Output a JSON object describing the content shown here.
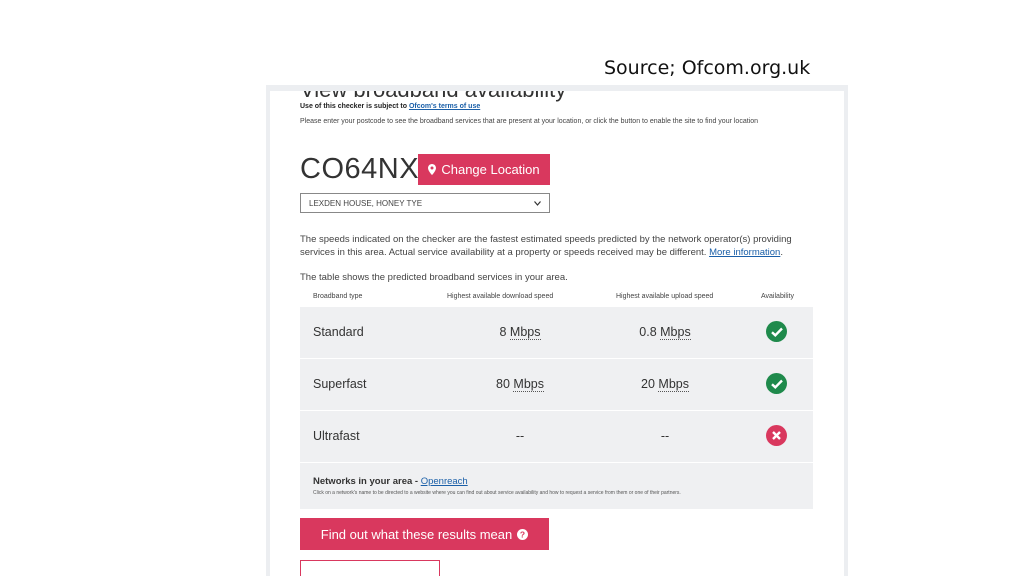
{
  "caption": "Source; Ofcom.org.uk",
  "page": {
    "heading": "View broadband availability",
    "terms_prefix": "Use of this checker is subject to ",
    "terms_link": "Ofcom's terms of use",
    "instructions": "Please enter your postcode to see the broadband services that are present at your location, or click the button to enable the site to find your location",
    "postcode": "CO64NX",
    "change_location_label": "Change Location",
    "address_selected": "LEXDEN HOUSE, HONEY TYE",
    "info_text": "The speeds indicated on the checker are the fastest estimated speeds predicted by the network operator(s) providing services in this area. Actual service availability at a property or speeds received may be different.",
    "more_info_link": "More information",
    "table_intro": "The table shows the predicted broadband services in your area.",
    "find_out_label": "Find out what these results mean"
  },
  "table": {
    "headers": {
      "type": "Broadband type",
      "download": "Highest available download speed",
      "upload": "Highest available upload speed",
      "availability": "Availability"
    },
    "rows": [
      {
        "type": "Standard",
        "down_value": "8",
        "down_unit": "Mbps",
        "up_value": "0.8",
        "up_unit": "Mbps",
        "available": true
      },
      {
        "type": "Superfast",
        "down_value": "80",
        "down_unit": "Mbps",
        "up_value": "20",
        "up_unit": "Mbps",
        "available": true
      },
      {
        "type": "Ultrafast",
        "down_value": "--",
        "down_unit": "",
        "up_value": "--",
        "up_unit": "",
        "available": false
      }
    ],
    "networks_label": "Networks in your area - ",
    "networks_link": "Openreach",
    "networks_desc": "Click on a network's name to be directed to a website where you can find out about service availability and how to request a service from them or one of their partners."
  },
  "colors": {
    "accent": "#d9385e",
    "available": "#1f8a4c",
    "unavailable": "#d9385e"
  },
  "icons": {
    "location": "map-marker-icon",
    "ok": "check-circle-icon",
    "no": "x-circle-icon",
    "help": "question-circle-icon",
    "dropdown": "chevron-down-icon"
  }
}
